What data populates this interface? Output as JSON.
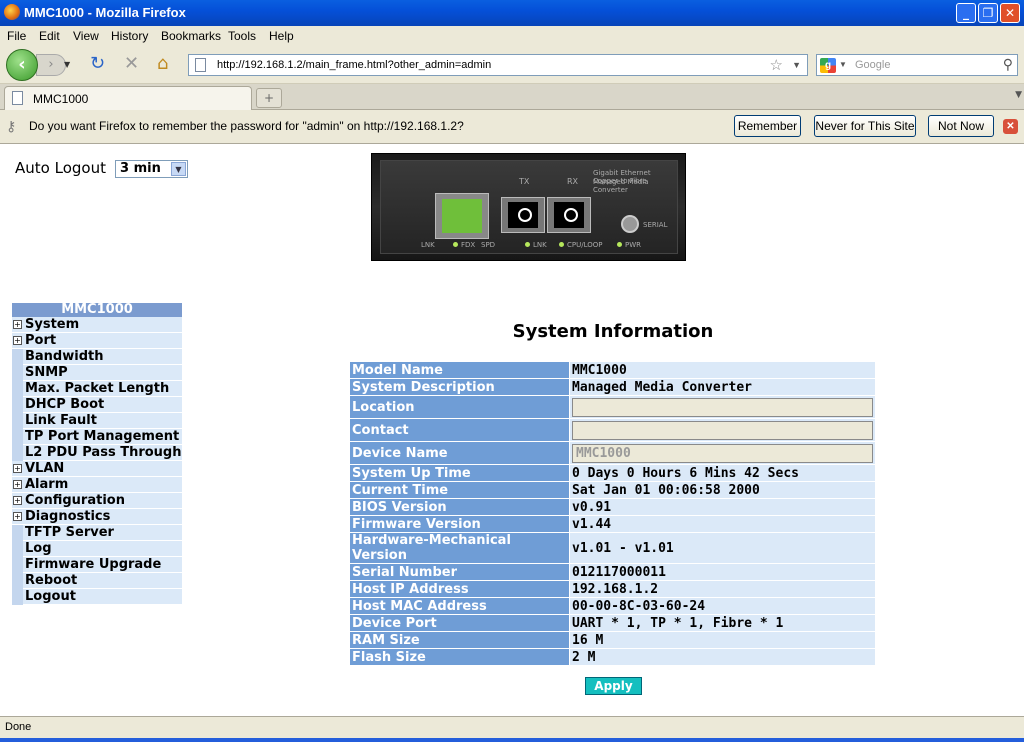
{
  "window": {
    "title": "MMC1000 - Mozilla Firefox"
  },
  "menu": [
    "File",
    "Edit",
    "View",
    "History",
    "Bookmarks",
    "Tools",
    "Help"
  ],
  "nav": {
    "url": "http://192.168.1.2/main_frame.html?other_admin=admin",
    "search_placeholder": "Google"
  },
  "tab": {
    "label": "MMC1000"
  },
  "notification": {
    "message": "Do you want Firefox to remember the password for \"admin\" on http://192.168.1.2?",
    "remember": "Remember",
    "never": "Never for This Site",
    "not_now": "Not Now"
  },
  "autologout": {
    "label": "Auto Logout",
    "value": "3 min"
  },
  "device": {
    "tx": "TX",
    "rx": "RX",
    "desc_line1": "Gigabit Ethernet Copper to Fibre",
    "desc_line2": "Managed Media Converter",
    "serial": "SERIAL",
    "lnk": "LNK",
    "fdx": "FDX",
    "spd": "SPD",
    "lnk2": "LNK",
    "cpu_loop": "CPU/LOOP",
    "pwr": "PWR"
  },
  "sidebar": {
    "header": "MMC1000",
    "items": [
      {
        "label": "System",
        "plus": true
      },
      {
        "label": "Port",
        "plus": true
      },
      {
        "label": "Bandwidth",
        "plus": false
      },
      {
        "label": "SNMP",
        "plus": false
      },
      {
        "label": "Max. Packet Length",
        "plus": false
      },
      {
        "label": "DHCP Boot",
        "plus": false
      },
      {
        "label": "Link Fault Passthrough",
        "plus": false
      },
      {
        "label": "TP Port Management",
        "plus": false
      },
      {
        "label": "L2 PDU Pass Through",
        "plus": false
      },
      {
        "label": "VLAN",
        "plus": true
      },
      {
        "label": "Alarm",
        "plus": true
      },
      {
        "label": "Configuration",
        "plus": true
      },
      {
        "label": "Diagnostics",
        "plus": true
      },
      {
        "label": "TFTP Server",
        "plus": false
      },
      {
        "label": "Log",
        "plus": false
      },
      {
        "label": "Firmware Upgrade",
        "plus": false
      },
      {
        "label": "Reboot",
        "plus": false
      },
      {
        "label": "Logout",
        "plus": false
      }
    ]
  },
  "main": {
    "title": "System Information",
    "rows": [
      {
        "key": "Model Name",
        "value": "MMC1000"
      },
      {
        "key": "System Description",
        "value": "Managed Media Converter"
      },
      {
        "key": "Location",
        "input": ""
      },
      {
        "key": "Contact",
        "input": ""
      },
      {
        "key": "Device Name",
        "input": "MMC1000"
      },
      {
        "key": "System Up Time",
        "value": "0 Days 0 Hours 6 Mins 42 Secs"
      },
      {
        "key": "Current Time",
        "value": "Sat Jan 01 00:06:58 2000"
      },
      {
        "key": "BIOS Version",
        "value": "v0.91"
      },
      {
        "key": "Firmware Version",
        "value": "v1.44"
      },
      {
        "key": "Hardware-Mechanical Version",
        "value": "v1.01 - v1.01"
      },
      {
        "key": "Serial Number",
        "value": "012117000011"
      },
      {
        "key": "Host IP Address",
        "value": "192.168.1.2"
      },
      {
        "key": "Host MAC Address",
        "value": "00-00-8C-03-60-24"
      },
      {
        "key": "Device Port",
        "value": "UART * 1, TP * 1, Fibre * 1"
      },
      {
        "key": "RAM Size",
        "value": "16 M"
      },
      {
        "key": "Flash Size",
        "value": "2 M"
      }
    ],
    "apply": "Apply"
  },
  "status": {
    "text": "Done"
  }
}
